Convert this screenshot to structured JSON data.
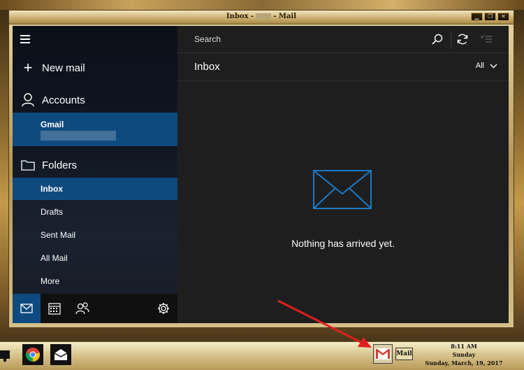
{
  "window": {
    "title_prefix": "Inbox -",
    "title_suffix": "- Mail",
    "buttons": {
      "minimize": "▁",
      "restore": "❐",
      "close": "✕"
    }
  },
  "sidebar": {
    "new_mail": "New mail",
    "accounts": "Accounts",
    "account_name": "Gmail",
    "folders": "Folders",
    "folder_items": [
      {
        "label": "Inbox",
        "selected": true
      },
      {
        "label": "Drafts",
        "selected": false
      },
      {
        "label": "Sent Mail",
        "selected": false
      },
      {
        "label": "All Mail",
        "selected": false
      },
      {
        "label": "More",
        "selected": false
      }
    ],
    "bottom_icons": [
      "mail-icon",
      "calendar-icon",
      "people-icon",
      "settings-icon"
    ]
  },
  "main": {
    "search_placeholder": "Search",
    "list_title": "Inbox",
    "filter_label": "All",
    "empty_message": "Nothing has arrived yet."
  },
  "taskbar": {
    "items": [
      "monitor-icon",
      "chrome-icon",
      "mail-app-icon",
      "gmail-icon"
    ],
    "mail_label": "Mail",
    "clock_time": "8:11 AM",
    "clock_day": "Sunday",
    "clock_date": "Sunday, March, 19, 2017"
  },
  "colors": {
    "accent": "#0f4a7f",
    "empty_icon": "#1a7ac7",
    "annotation_arrow": "#e21f1f"
  }
}
